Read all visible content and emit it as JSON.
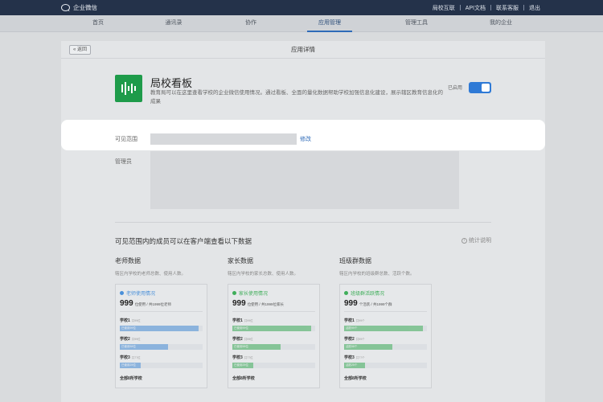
{
  "topbar": {
    "brand": "企业微信",
    "links": [
      "局校互联",
      "API文档",
      "联系客服",
      "退出"
    ]
  },
  "nav": {
    "items": [
      "首页",
      "通讯录",
      "协作",
      "应用管理",
      "管理工具",
      "我的企业"
    ],
    "active": "应用管理"
  },
  "page": {
    "back_label": "« 返回",
    "title": "应用详情"
  },
  "app": {
    "name": "局校看板",
    "description": "教育局可以在这里查看学校的企业微信使用情况。通过看板、全面的量化数据帮助学校加强信息化建设，展示辖区教育信息化的成果",
    "status_label": "已启用",
    "enabled": true,
    "icon_color": "#1e9b4a"
  },
  "fields": {
    "scope_label": "可见范围",
    "scope_value": "",
    "modify_label": "修改",
    "admin_label": "管理员"
  },
  "stats": {
    "section_title": "可见范围内的成员可以在客户端查看以下数据",
    "help_label": "统计说明",
    "columns": [
      {
        "title": "老师数据",
        "desc": "辖区内学校的老师总数、使用人数。",
        "panel_title": "老师使用情况",
        "color": "#4a90d9",
        "total": "999",
        "total_suffix": "位使用 / 共1999位老师",
        "rows": [
          {
            "name": "学校1",
            "sub": "共99位",
            "fill": 0.95,
            "bar_text": "已使用99位"
          },
          {
            "name": "学校2",
            "sub": "共99位",
            "fill": 0.58,
            "bar_text": "已使用58位"
          },
          {
            "name": "学校3",
            "sub": "共77位",
            "fill": 0.25,
            "bar_text": "已使用25位"
          }
        ],
        "footer": "全部8所学校"
      },
      {
        "title": "家长数据",
        "desc": "辖区内学校的家长总数、使用人数。",
        "panel_title": "家长使用情况",
        "color": "#3fae5a",
        "total": "999",
        "total_suffix": "位使用 / 共1999位家长",
        "rows": [
          {
            "name": "学校1",
            "sub": "共99位",
            "fill": 0.95,
            "bar_text": "已使用99位"
          },
          {
            "name": "学校2",
            "sub": "共99位",
            "fill": 0.58,
            "bar_text": "已使用58位"
          },
          {
            "name": "学校3",
            "sub": "共77位",
            "fill": 0.25,
            "bar_text": "已使用25位"
          }
        ],
        "footer": "全部8所学校"
      },
      {
        "title": "班级群数据",
        "desc": "辖区内学校的班级群总数、活跃个数。",
        "panel_title": "班级群活跃情况",
        "color": "#3fae5a",
        "total": "999",
        "total_suffix": "个活跃 / 共1999个群",
        "rows": [
          {
            "name": "学校1",
            "sub": "共99个",
            "fill": 0.95,
            "bar_text": "活跃99个"
          },
          {
            "name": "学校2",
            "sub": "共99个",
            "fill": 0.58,
            "bar_text": "活跃58个"
          },
          {
            "name": "学校3",
            "sub": "共77个",
            "fill": 0.25,
            "bar_text": "活跃25个"
          }
        ],
        "footer": "全部8所学校"
      }
    ]
  }
}
